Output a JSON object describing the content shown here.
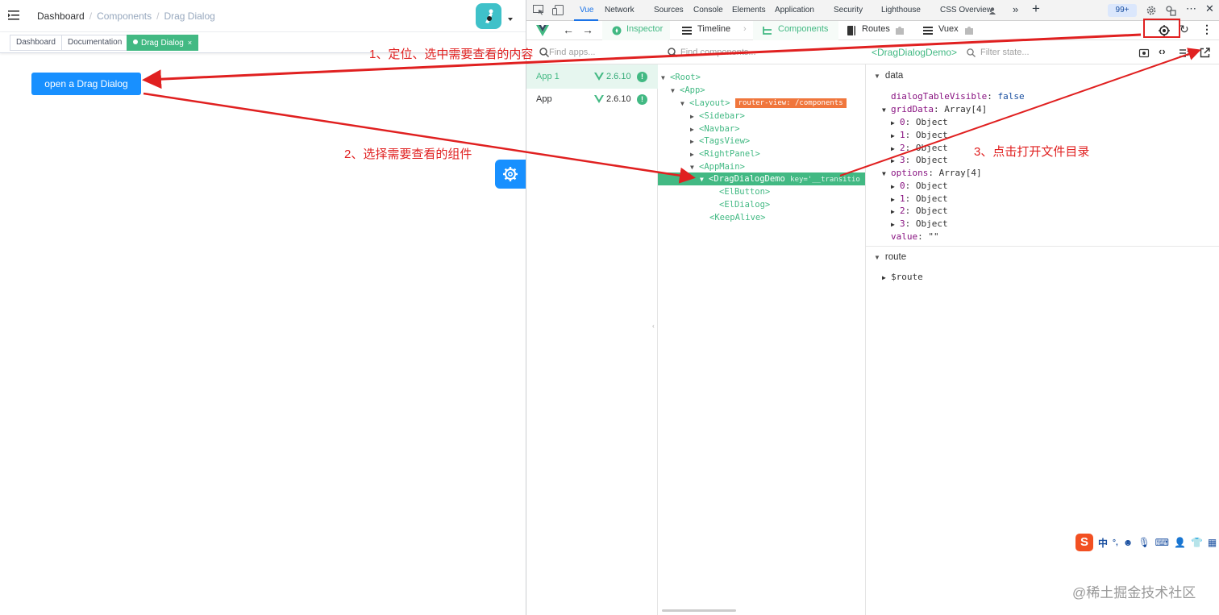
{
  "left_app": {
    "breadcrumb": [
      "Dashboard",
      "Components",
      "Drag Dialog"
    ],
    "breadcrumb_sep": "/",
    "tags": [
      "Dashboard",
      "Documentation",
      "Drag Dialog"
    ],
    "tag_close": "×",
    "open_button": "open a Drag Dialog"
  },
  "devtools": {
    "tabs": [
      "Vue",
      "Network",
      "Sources",
      "Console",
      "Elements",
      "Application",
      "Security",
      "Lighthouse",
      "CSS Overview"
    ],
    "badge": "99+",
    "vue_toolbar": {
      "inspector": "Inspector",
      "timeline": "Timeline",
      "components": "Components",
      "routes": "Routes",
      "vuex": "Vuex"
    },
    "search": {
      "apps_placeholder": "Find apps...",
      "components_placeholder": "Find components...",
      "selected_component": "<DragDialogDemo>",
      "state_placeholder": "Filter state..."
    },
    "apps": [
      {
        "name": "App 1",
        "version": "2.6.10"
      },
      {
        "name": "App",
        "version": "2.6.10"
      }
    ],
    "tree": [
      {
        "label": "<Root>",
        "arrow": "▼"
      },
      {
        "label": "<App>",
        "arrow": "▼"
      },
      {
        "label": "<Layout>",
        "arrow": "▼",
        "badge": "router-view: /components"
      },
      {
        "label": "<Sidebar>",
        "arrow": "▶"
      },
      {
        "label": "<Navbar>",
        "arrow": "▶"
      },
      {
        "label": "<TagsView>",
        "arrow": "▶"
      },
      {
        "label": "<RightPanel>",
        "arrow": "▶"
      },
      {
        "label": "<AppMain>",
        "arrow": "▼"
      },
      {
        "label": "<DragDialogDemo",
        "arrow": "▼",
        "attr": "key='__transitio"
      },
      {
        "label": "<ElButton>",
        "arrow": ""
      },
      {
        "label": "<ElDialog>",
        "arrow": ""
      },
      {
        "label": "<KeepAlive>",
        "arrow": ""
      }
    ],
    "state": {
      "data_title": "data",
      "data_props": [
        {
          "key": "dialogTableVisible",
          "value": "false",
          "arrow": ""
        },
        {
          "key": "gridData",
          "value": "Array[4]",
          "arrow": "▼"
        },
        {
          "key": "0",
          "value": "Object",
          "arrow": "▶"
        },
        {
          "key": "1",
          "value": "Object",
          "arrow": "▶"
        },
        {
          "key": "2",
          "value": "Object",
          "arrow": "▶"
        },
        {
          "key": "3",
          "value": "Object",
          "arrow": "▶"
        },
        {
          "key": "options",
          "value": "Array[4]",
          "arrow": "▼"
        },
        {
          "key": "0",
          "value": "Object",
          "arrow": "▶"
        },
        {
          "key": "1",
          "value": "Object",
          "arrow": "▶"
        },
        {
          "key": "2",
          "value": "Object",
          "arrow": "▶"
        },
        {
          "key": "3",
          "value": "Object",
          "arrow": "▶"
        },
        {
          "key": "value",
          "value": "\"\"",
          "arrow": ""
        }
      ],
      "route_title": "route",
      "route_prop": "$route"
    }
  },
  "annotations": {
    "step1": "1、定位、选中需要查看的内容",
    "step2": "2、选择需要查看的组件",
    "step3": "3、点击打开文件目录"
  },
  "ime": [
    "中",
    "°,"
  ],
  "watermark": "@稀土掘金技术社区",
  "colors": {
    "vue_green": "#42b983",
    "primary_blue": "#1890ff",
    "annotation_red": "#e02020",
    "router_badge": "#f0763c"
  }
}
